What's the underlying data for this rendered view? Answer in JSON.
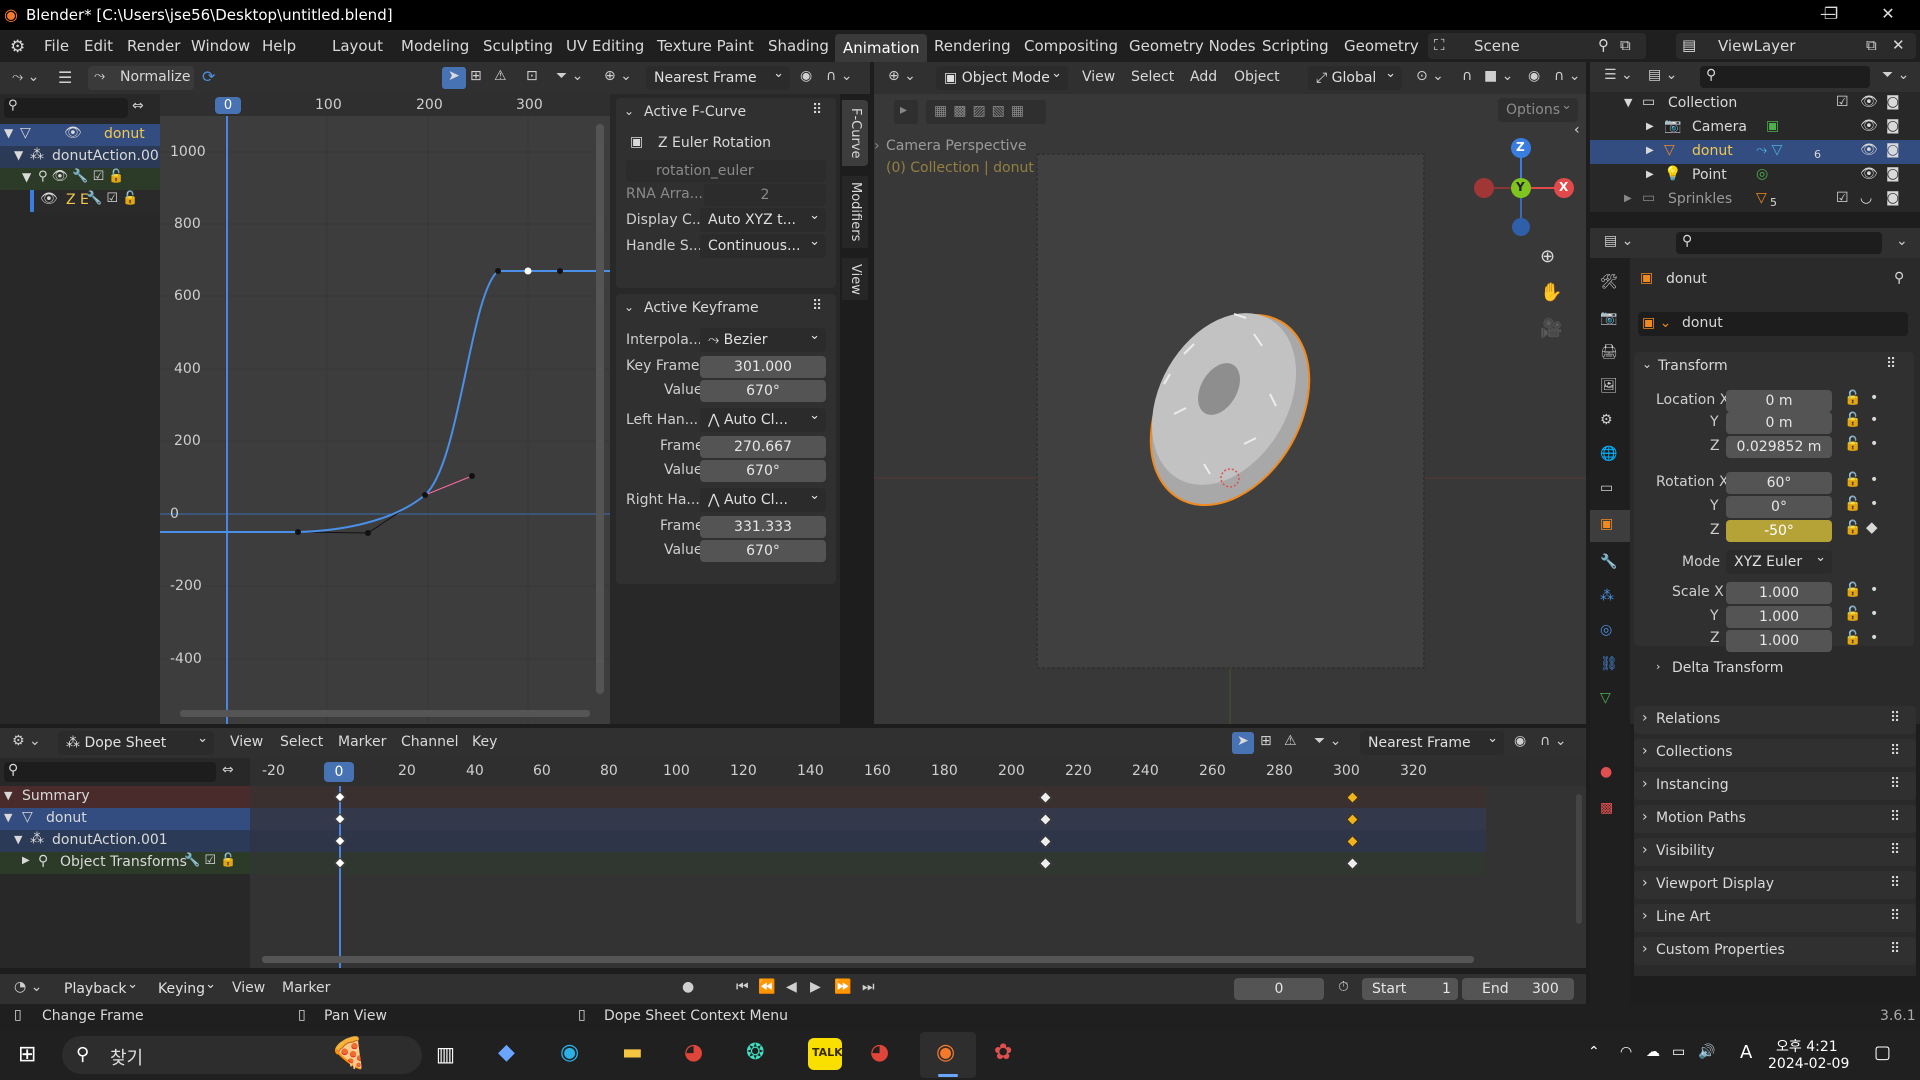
{
  "titlebar": {
    "title": "Blender* [C:\\Users\\jse56\\Desktop\\untitled.blend]",
    "min": "—",
    "max": "❐",
    "close": "✕"
  },
  "menu": [
    "File",
    "Edit",
    "Render",
    "Window",
    "Help"
  ],
  "workspaces": [
    "Layout",
    "Modeling",
    "Sculpting",
    "UV Editing",
    "Texture Paint",
    "Shading",
    "Animation",
    "Rendering",
    "Compositing",
    "Geometry Nodes",
    "Scripting",
    "Geometry"
  ],
  "scene": {
    "label": "Scene",
    "viewlayer": "ViewLayer"
  },
  "graph": {
    "normalize": "Normalize",
    "snap": "Nearest Frame",
    "current_frame": "0",
    "xticks": [
      "0",
      "100",
      "200",
      "300"
    ],
    "yticks": [
      "1000",
      "800",
      "600",
      "400",
      "200",
      "0",
      "-200",
      "-400"
    ],
    "channels": [
      "donut",
      "donutAction.001",
      "",
      "Z E"
    ]
  },
  "fcurve_panel": {
    "tabs": [
      "F-Curve",
      "Modifiers",
      "View"
    ],
    "active_fcurve": "Active F-Curve",
    "name": "Z Euler Rotation",
    "path": "rotation_euler",
    "rna_label": "RNA Arra...",
    "rna_value": "2",
    "display_label": "Display C...",
    "display_value": "Auto XYZ t...",
    "handle_label": "Handle S...",
    "handle_value": "Continuous...",
    "active_keyframe": "Active Keyframe",
    "interp_label": "Interpola...",
    "interp_value": "Bezier",
    "keyframe_label": "Key Frame",
    "keyframe_value": "301.000",
    "value_label": "Value",
    "value_value": "670°",
    "lefthan_label": "Left Han...",
    "lefthan_value": "Auto Cl...",
    "lframe_label": "Frame",
    "lframe_value": "270.667",
    "lvalue_label": "Value",
    "lvalue_value": "670°",
    "righthan_label": "Right Ha...",
    "righthan_value": "Auto Cl...",
    "rframe_label": "Frame",
    "rframe_value": "331.333",
    "rvalue_label": "Value",
    "rvalue_value": "670°"
  },
  "viewport": {
    "mode": "Object Mode",
    "menus": [
      "View",
      "Select",
      "Add",
      "Object"
    ],
    "orientation": "Global",
    "options": "Options",
    "persp": "Camera Perspective",
    "context": "(0) Collection | donut"
  },
  "outliner": {
    "items": [
      {
        "label": "Collection"
      },
      {
        "label": "Camera"
      },
      {
        "label": "donut"
      },
      {
        "label": "Point"
      },
      {
        "label": "Sprinkles"
      }
    ],
    "badge_donut": "6",
    "badge_sprinkles": "5"
  },
  "properties": {
    "object_name": "donut",
    "data_name": "donut",
    "transform": "Transform",
    "locx_label": "Location X",
    "locx": "0 m",
    "locy_label": "Y",
    "locy": "0 m",
    "locz_label": "Z",
    "locz": "0.029852 m",
    "rotx_label": "Rotation X",
    "rotx": "60°",
    "roty_label": "Y",
    "roty": "0°",
    "rotz_label": "Z",
    "rotz": "-50°",
    "mode_label": "Mode",
    "mode": "XYZ Euler",
    "scalex_label": "Scale X",
    "scalex": "1.000",
    "scaley_label": "Y",
    "scaley": "1.000",
    "scalez_label": "Z",
    "scalez": "1.000",
    "delta": "Delta Transform",
    "sections": [
      "Relations",
      "Collections",
      "Instancing",
      "Motion Paths",
      "Visibility",
      "Viewport Display",
      "Line Art",
      "Custom Properties"
    ]
  },
  "dopesheet": {
    "editor": "Dope Sheet",
    "menus": [
      "View",
      "Select",
      "Marker",
      "Channel",
      "Key"
    ],
    "snap": "Nearest Frame",
    "current_frame": "0",
    "ticks": [
      "-20",
      "20",
      "40",
      "60",
      "80",
      "100",
      "120",
      "140",
      "160",
      "180",
      "200",
      "220",
      "240",
      "260",
      "280",
      "300",
      "320"
    ],
    "channels": [
      "Summary",
      "donut",
      "donutAction.001",
      "Object Transforms"
    ]
  },
  "timeline": {
    "playback": "Playback",
    "keying": "Keying",
    "view": "View",
    "marker": "Marker",
    "frame": "0",
    "start_label": "Start",
    "start": "1",
    "end_label": "End",
    "end": "300"
  },
  "statusbar": {
    "change_frame": "Change Frame",
    "pan_view": "Pan View",
    "context_menu": "Dope Sheet Context Menu",
    "version": "3.6.1"
  },
  "taskbar": {
    "search": "찾기",
    "time": "오후 4:21",
    "date": "2024-02-09",
    "ime": "A",
    "talk": "TALK"
  }
}
